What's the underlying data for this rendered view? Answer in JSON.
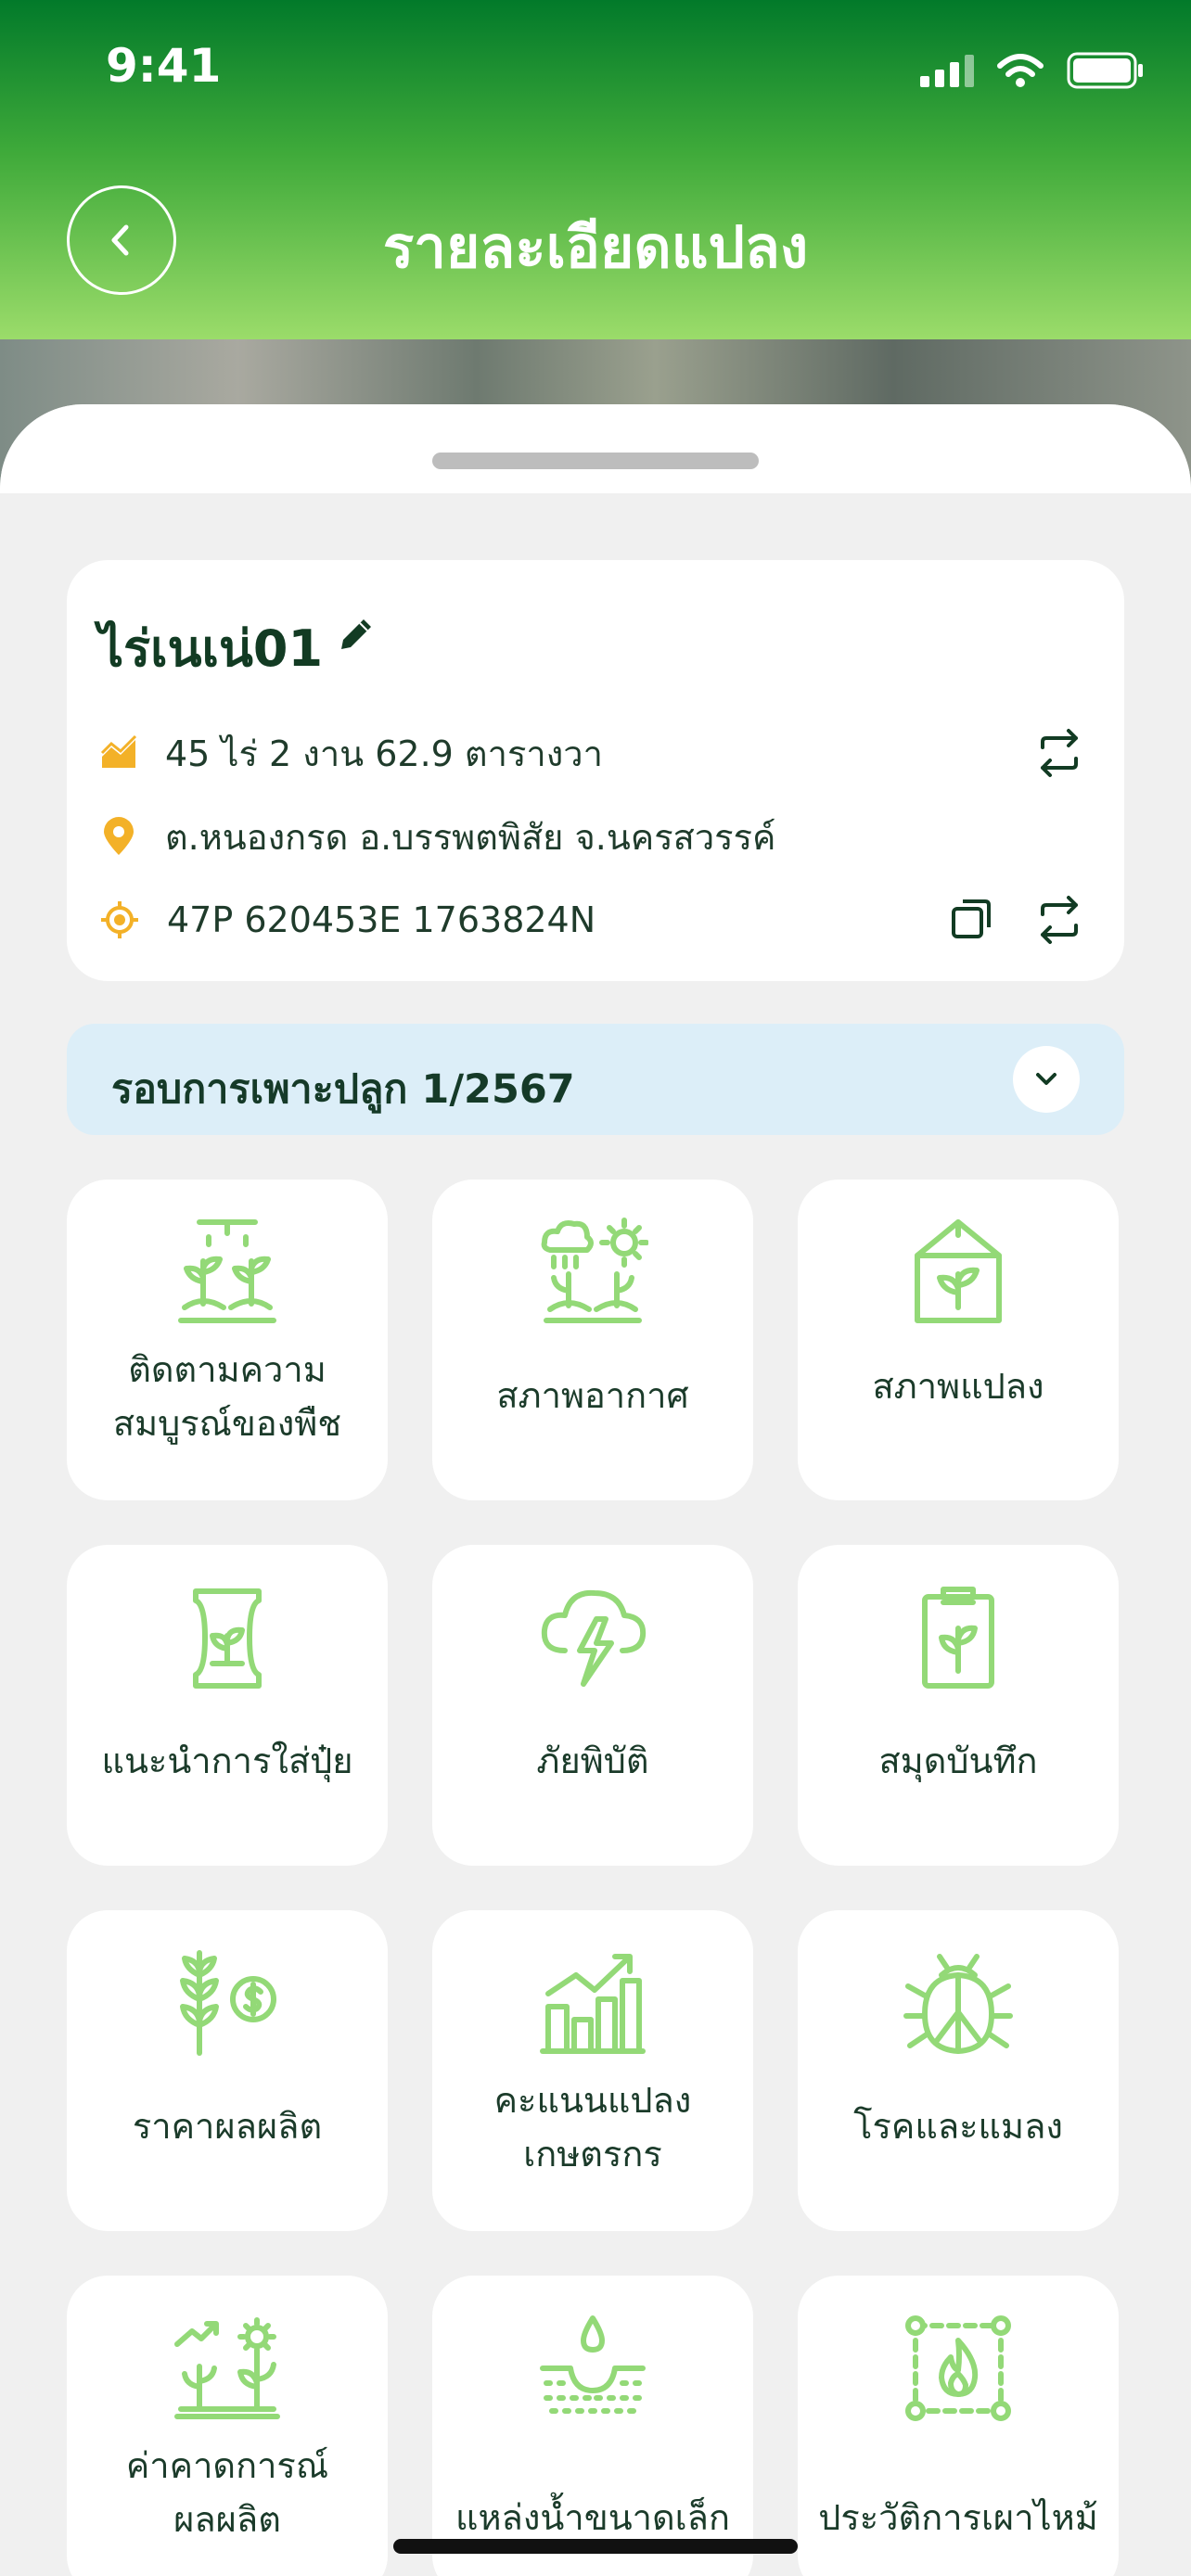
{
  "status_bar": {
    "time": "9:41"
  },
  "header": {
    "title": "รายละเอียดแปลง",
    "back_icon": "chevron-left-icon"
  },
  "plot": {
    "name": "ไร่เนเน่01",
    "area": "45 ไร่ 2 งาน 62.9 ตารางวา",
    "address": "ต.หนองกรด อ.บรรพตพิสัย จ.นครสวรรค์",
    "coordinates": "47P 620453E 1763824N"
  },
  "season": {
    "label": "รอบการเพาะปลูก 1/2567"
  },
  "colors": {
    "accent": "#93d977",
    "header_dark": "#027a2a",
    "icon_orange": "#f3b128"
  },
  "menu": [
    {
      "label": "ติดตามความ\nสมบูรณ์ของพืช",
      "icon": "plant-growth-icon"
    },
    {
      "label": "สภาพอากาศ",
      "icon": "weather-icon"
    },
    {
      "label": "สภาพแปลง",
      "icon": "greenhouse-icon"
    },
    {
      "label": "แนะนำการใส่ปุ๋ย",
      "icon": "fertilizer-bag-icon"
    },
    {
      "label": "ภัยพิบัติ",
      "icon": "storm-icon"
    },
    {
      "label": "สมุดบันทึก",
      "icon": "clipboard-plant-icon"
    },
    {
      "label": "ราคาผลผลิต",
      "icon": "grain-price-icon"
    },
    {
      "label": "คะแนนแปลง\nเกษตรกร",
      "icon": "bar-chart-icon"
    },
    {
      "label": "โรคและแมลง",
      "icon": "bug-icon"
    },
    {
      "label": "ค่าคาดการณ์\nผลผลิต",
      "icon": "yield-forecast-icon"
    },
    {
      "label": "แหล่งน้ำขนาดเล็ก",
      "icon": "water-source-icon"
    },
    {
      "label": "ประวัติการเผาไหม้",
      "icon": "burn-history-icon"
    }
  ]
}
